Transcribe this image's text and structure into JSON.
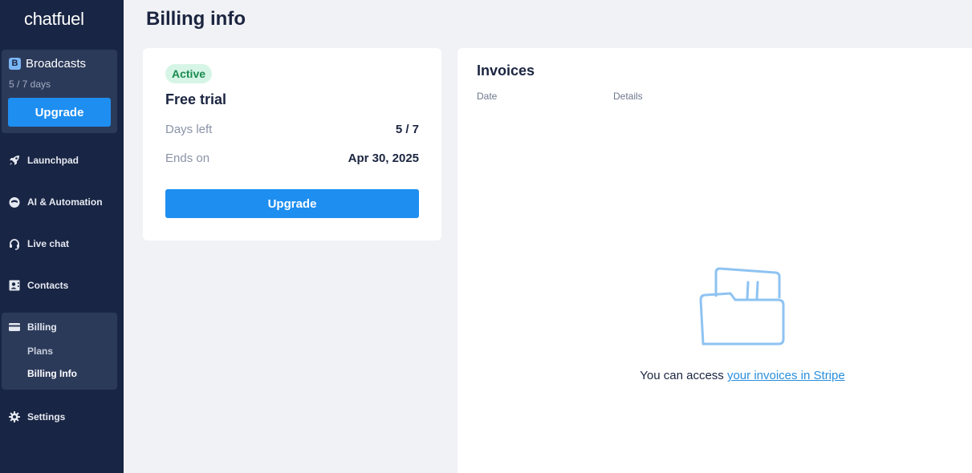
{
  "app": {
    "logo": "chatfuel"
  },
  "workspace": {
    "badge": "B",
    "name": "Broadcasts",
    "days": "5 / 7 days",
    "upgrade_label": "Upgrade"
  },
  "nav": {
    "launchpad": "Launchpad",
    "ai_automation": "AI & Automation",
    "live_chat": "Live chat",
    "contacts": "Contacts",
    "billing": "Billing",
    "plans": "Plans",
    "billing_info": "Billing Info",
    "settings": "Settings"
  },
  "page": {
    "title": "Billing info"
  },
  "plan": {
    "status": "Active",
    "name": "Free trial",
    "days_left_label": "Days left",
    "days_left_value": "5 / 7",
    "ends_on_label": "Ends on",
    "ends_on_value": "Apr 30, 2025",
    "upgrade_label": "Upgrade"
  },
  "invoices": {
    "title": "Invoices",
    "col_date": "Date",
    "col_details": "Details",
    "empty_prefix": "You can access ",
    "empty_link": "your invoices in Stripe"
  },
  "colors": {
    "sidebar_bg": "#192544",
    "accent": "#1e8ef0",
    "active_pill_bg": "#d6f5e6",
    "active_pill_text": "#1a8a4e"
  }
}
